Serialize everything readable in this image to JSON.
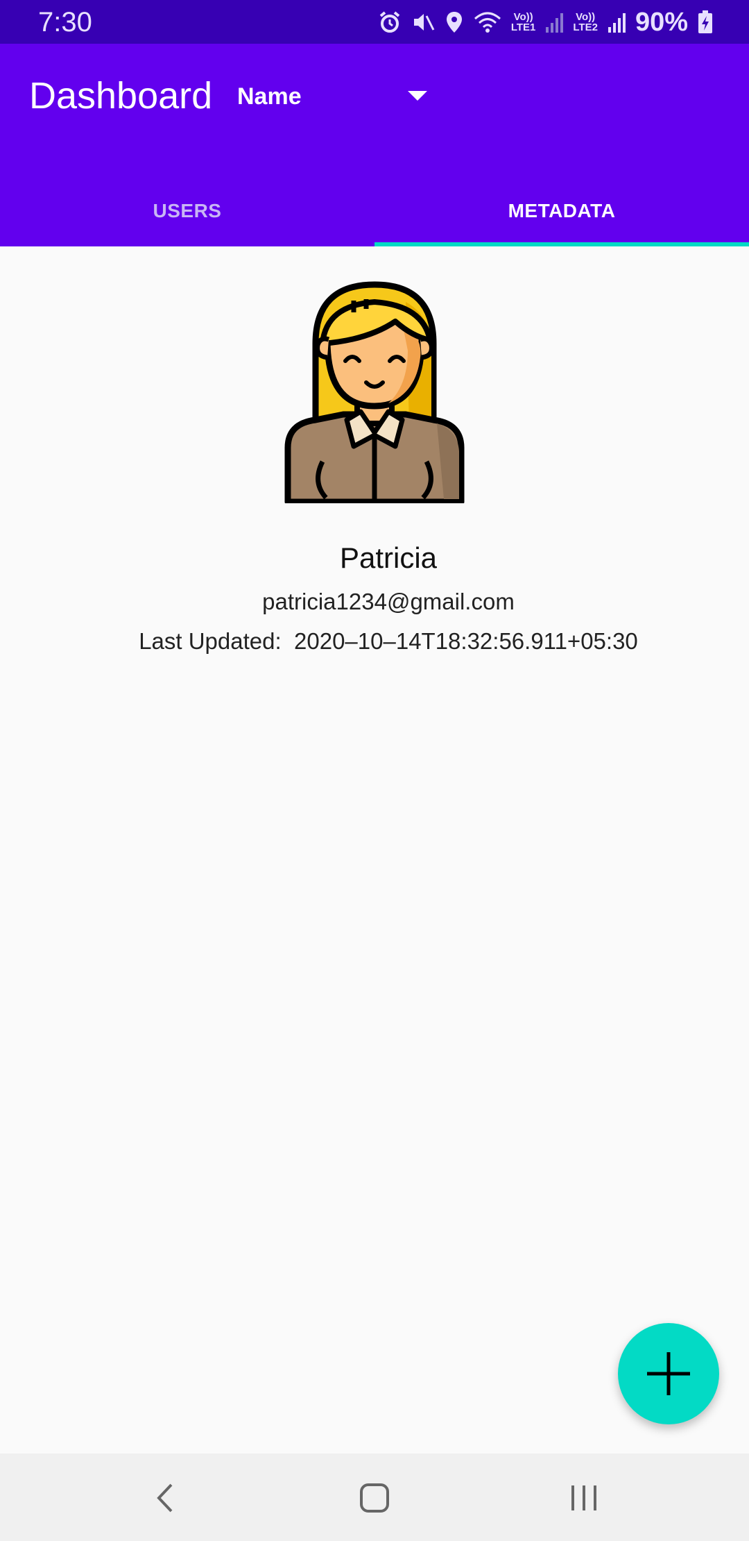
{
  "status_bar": {
    "time": "7:30",
    "sim1_label": "Vo))\nLTE1",
    "sim2_label": "Vo))\nLTE2",
    "battery": "90%"
  },
  "app_bar": {
    "title": "Dashboard",
    "sort_dropdown": {
      "selected": "Name"
    },
    "tabs": [
      {
        "label": "USERS",
        "active": false
      },
      {
        "label": "METADATA",
        "active": true
      }
    ]
  },
  "profile": {
    "name": "Patricia",
    "email": "patricia1234@gmail.com",
    "last_updated_label": "Last Updated:",
    "last_updated_value": "2020–10–14T18:32:56.911+05:30"
  },
  "colors": {
    "status_bar": "#3700b3",
    "primary": "#6200ee",
    "accent": "#03dac5",
    "background": "#fafafa"
  },
  "icons": {
    "status": [
      "alarm-icon",
      "mute-icon",
      "location-icon",
      "wifi-icon",
      "signal-icon",
      "battery-charging-icon"
    ],
    "fab": "plus-icon",
    "nav": [
      "back-icon",
      "home-icon",
      "recents-icon"
    ]
  }
}
